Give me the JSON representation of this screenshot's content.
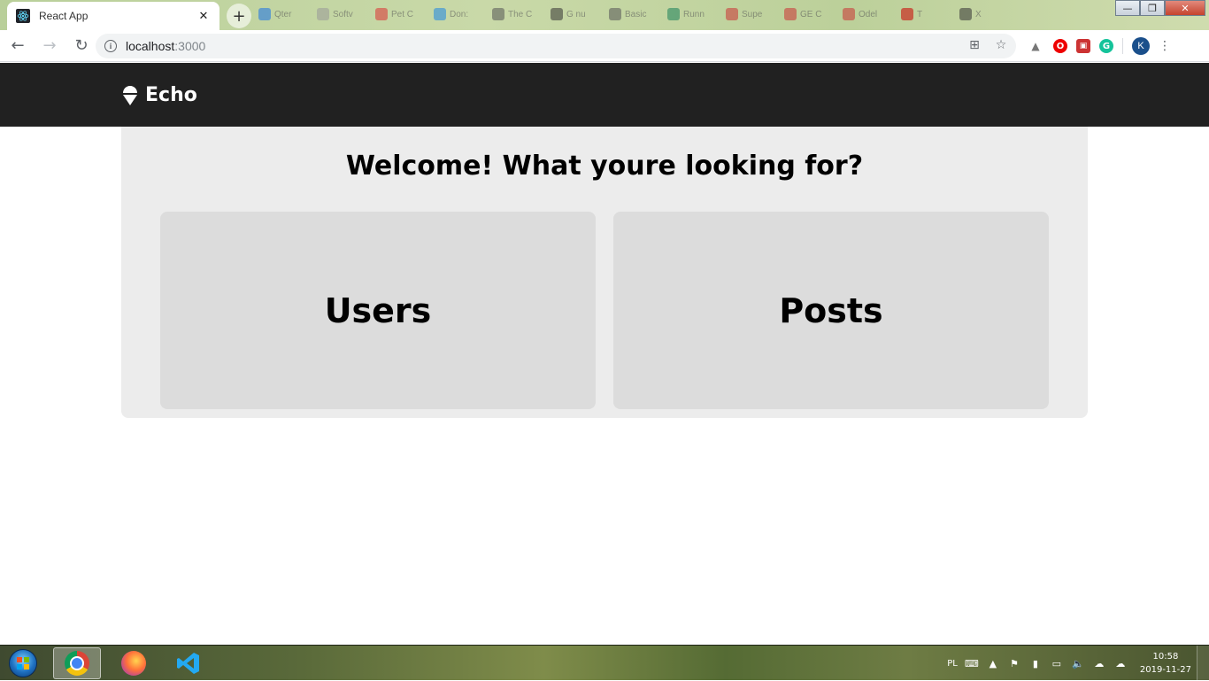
{
  "browser": {
    "tab_title": "React App",
    "tab_close": "✕",
    "new_tab": "+",
    "background_tabs": [
      "Qter",
      "Softv",
      "Pet C",
      "Don:",
      "The C",
      "G nu",
      "Basic",
      "Runn",
      "Supe",
      "GE C",
      "Odel",
      "T",
      "X"
    ],
    "url_host": "localhost",
    "url_port": ":3000",
    "profile_initial": "K",
    "window_controls": {
      "minimize": "—",
      "maximize": "❐",
      "close": "✕"
    }
  },
  "app": {
    "brand": "Echo",
    "welcome": "Welcome! What youre looking for?",
    "cards": [
      {
        "label": "Users"
      },
      {
        "label": "Posts"
      }
    ]
  },
  "taskbar": {
    "language": "PL",
    "time": "10:58",
    "date": "2019-11-27"
  },
  "colors": {
    "header_bg": "#212121",
    "panel_bg": "#ececec",
    "card_bg": "#dcdcdc"
  },
  "icons": {
    "back": "arrow-left-icon",
    "forward": "arrow-right-icon",
    "reload": "reload-icon",
    "info": "info-icon",
    "translate": "translate-icon",
    "bookmark": "star-icon",
    "menu": "menu-dots-icon",
    "brand": "ice-cream-icon"
  }
}
